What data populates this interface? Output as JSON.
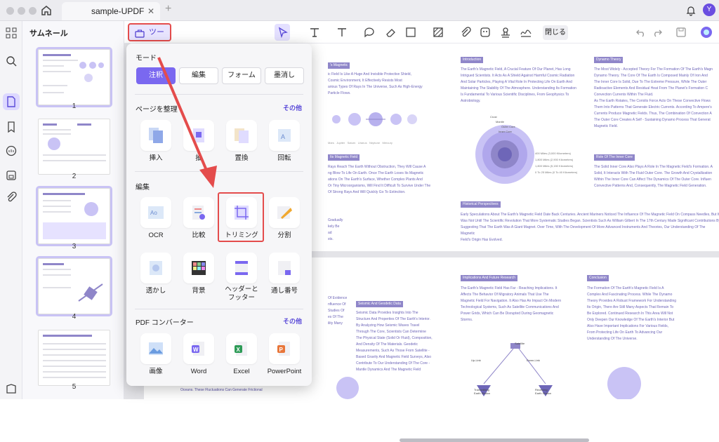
{
  "titlebar": {
    "tab_title": "sample-UPDF",
    "avatar_letter": "Y"
  },
  "sidebar": {
    "title": "サムネール",
    "pages": [
      "1",
      "2",
      "3",
      "4",
      "5"
    ]
  },
  "toolbar": {
    "tools_label": "ツール",
    "close_label": "閉じる"
  },
  "popup": {
    "mode_label": "モード",
    "modes": [
      "注釈",
      "編集",
      "フォーム",
      "墨消し"
    ],
    "organize_label": "ページを整理",
    "organize_more": "その他",
    "organize_items": [
      "挿入",
      "抽",
      "置換",
      "回転"
    ],
    "edit_label": "編集",
    "edit_items": [
      "OCR",
      "比較",
      "トリミング",
      "分割",
      "透かし",
      "背景",
      "ヘッダーと\nフッター",
      "通し番号"
    ],
    "converter_label": "PDF コンバーター",
    "converter_more": "その他",
    "converter_items": [
      "画像",
      "Word",
      "Excel",
      "PowerPoint"
    ]
  },
  "document": {
    "page1_col1_header": "'s Magnetic",
    "page1_col1_text": "ic Field Is Like A Huge And Invisible Protective Shield,\nCosmic Environment, It Effectively Resists Most\narious Types Of Rays In The Universe, Such As High-Energy\nParticle Flows.",
    "page1_planets": [
      "Mars",
      "Jupiter",
      "Saturn",
      "Uranus",
      "Neptune",
      "Mercury"
    ],
    "page1_col1_header2": "Its Magnetic Field",
    "page1_col1_text2": "Rays Reach The Earth Without Obstruction, They Will Cause A\nng Blow To Life On Earth. Once The Earth Loses Its Magnetic\nations On The Earth's Surface, Whether Complex Plants And\n Or Tiny Microorganisms, Will Find It Difficult To Survive Under The\nOf Strong Rays And Will Quickly Go To Extinction.",
    "page1_col1_text3": "Gradually\nkely Be\nad\nsts.",
    "page1_col2_header": "Introduction",
    "page1_col2_text": "The Earth's Magnetic Field, A Crucial Feature Of Our Planet, Has Long\nIntrigued Scientists. It Acts As A Shield Against Harmful Cosmic Radiation\nAnd Solar Particles, Playing A Vital Role In Protecting Life On Earth And\nMaintaining The Stability Of The Atmosphere. Understanding Its Formation\nIs Fundamental To Various Scientific Disciplines, From Geophysics To\nAstrobiology.",
    "page1_col2_labels": [
      "Crust",
      "Mantle",
      "Outer Core",
      "Inner Core"
    ],
    "page1_col2_depths": "400 Miles (3,000 Kilometers)\n1,800 Miles (2,900 Kilometers)\n1,800 Miles (5,150 Kilometers)\n0 To 25 Miles (0 To 40 Kilometers)",
    "page1_col2_header2": "Historical Perspectives",
    "page1_col2_text2": "Early Speculations About The Earth's Magnetic Field Date Back Centuries. Ancient Mariners Noticed The Influence Of The Magnetic Field On Compass Needles, But It\nWas Not Until The Scientific Revolution That More Systematic Studies Began. Scientists Such As William Gilbert In The 17th Century Made Significant Contributions By\nSuggesting That The Earth Was A Giant Magnet. Over Time, With The Development Of More Advanced Instruments And Theories, Our Understanding Of The Magnetic\nField's Origin Has Evolved.",
    "page1_col3_header": "Dynamo Theory",
    "page1_col3_text": "The Most Widely - Accepted Theory For The Formation Of The Earth's Magn\nDynamo Theory. The Core Of The Earth Is Composed Mainly Of Iron And\nThe Inner Core Is Solid, Due To The Extreme Pressure, While The Outer\nRadioactive Elements And Residual Heat From The Planet's Formation C\nConvection Currents Within The Fluid.\nAs The Earth Rotates, The Coriolis Force Acts On These Convective Flows\nThem Into Patterns That Generate Electric Currents. According To Ampere's\nCurrents Produce Magnetic Fields. Thus, The Combination Of Convection A\nThe Outer Core Creates A Self - Sustaining Dynamo Process That Generat\nMagnetic Field.",
    "page1_col3_header2": "Role Of The Inner Core",
    "page1_col3_text2": "The Solid Inner Core Also Plays A Role In The Magnetic Field's Formation. A\nSolid, It Interacts With The Fluid Outer Core. The Growth And Crystallization\nWithin The Inner Core Can Affect The Dynamics Of The Outer Core. Influen\nConvective Patterns And, Consequently, The Magnetic Field Generation.",
    "page2_header1": "Seismic And Geodetic Data",
    "page2_text1": "Seismic Data Provides Insights Into The\nStructure And Properties Of The Earth's Interior.\nBy Analyzing How Seismic Waves Travel\nThrough The Core, Scientists Can Determine\nThe Physical State (Solid Or Fluid), Composition,\nAnd Density Of The Materials. Geodetic\nMeasurements, Such As Those From Satellite -\nBased Gravity And Magnetic Field Surveys, Also\nContribute To Our Understanding Of The Core -\nMantle Dynamics And The Magnetic Field",
    "page2_text0": "Of Evidence\nnfluence Of\nStudies Of\nes Of The\nility Many",
    "page2_header2": "Implications And Future Research",
    "page2_text2": "The Earth's Magnetic Field Has Far - Reaching Implications. It\nAffects The Behavior Of Migratory Animals That Use The\nMagnetic Field For Navigation. It Also Has An Impact On Modern\nTechnological Systems, Such As Satellite Communications And\nPower Grids, Which Can Be Disrupted During Geomagnetic\nStorms.",
    "page2_sat_labels": [
      "Satellite",
      "Up-Link",
      "Down-Link",
      "Transmitting\nEarth Station",
      "Receiving\nEarth Station"
    ],
    "page2_header3": "Conclusion",
    "page2_text3": "The Formation Of The Earth's Magnetic Field Is A\nComplex And Fascinating Process. While The Dynamo\nTheory Provides A Robust Framework For Understanding\nIts Origin, There Are Still Many Aspects That Remain To\nBe Explored. Continued Research In This Area Will Not\nOnly Deepen Our Knowledge Of The Earth's Interior But\nAlso Have Important Implications For Various Fields,\nFrom Protecting Life On Earth To Advancing Our\nUnderstanding Of The Universe.",
    "page2_bottom": "Oceans. These Fluctuations Can Generate Frictional"
  }
}
